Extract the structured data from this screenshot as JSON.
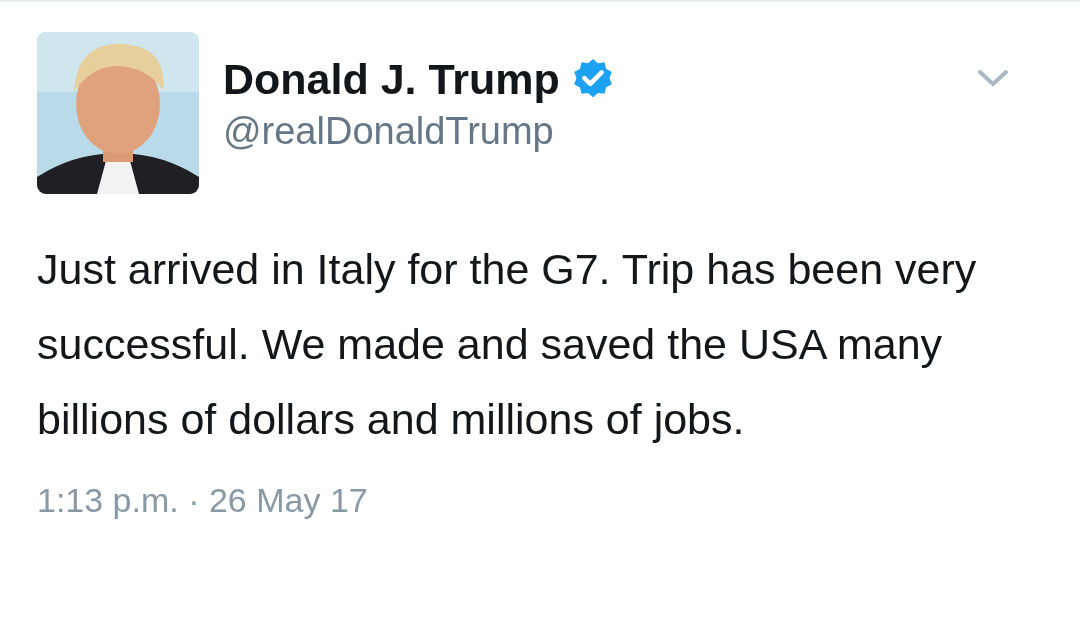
{
  "tweet": {
    "author": {
      "name": "Donald J. Trump",
      "verified": true,
      "handle": "@realDonaldTrump"
    },
    "text": "Just arrived in Italy for the G7. Trip has been very successful. We made and saved the USA many billions of dollars and millions of jobs.",
    "timestamp": "1:13 p.m. · 26 May 17"
  }
}
